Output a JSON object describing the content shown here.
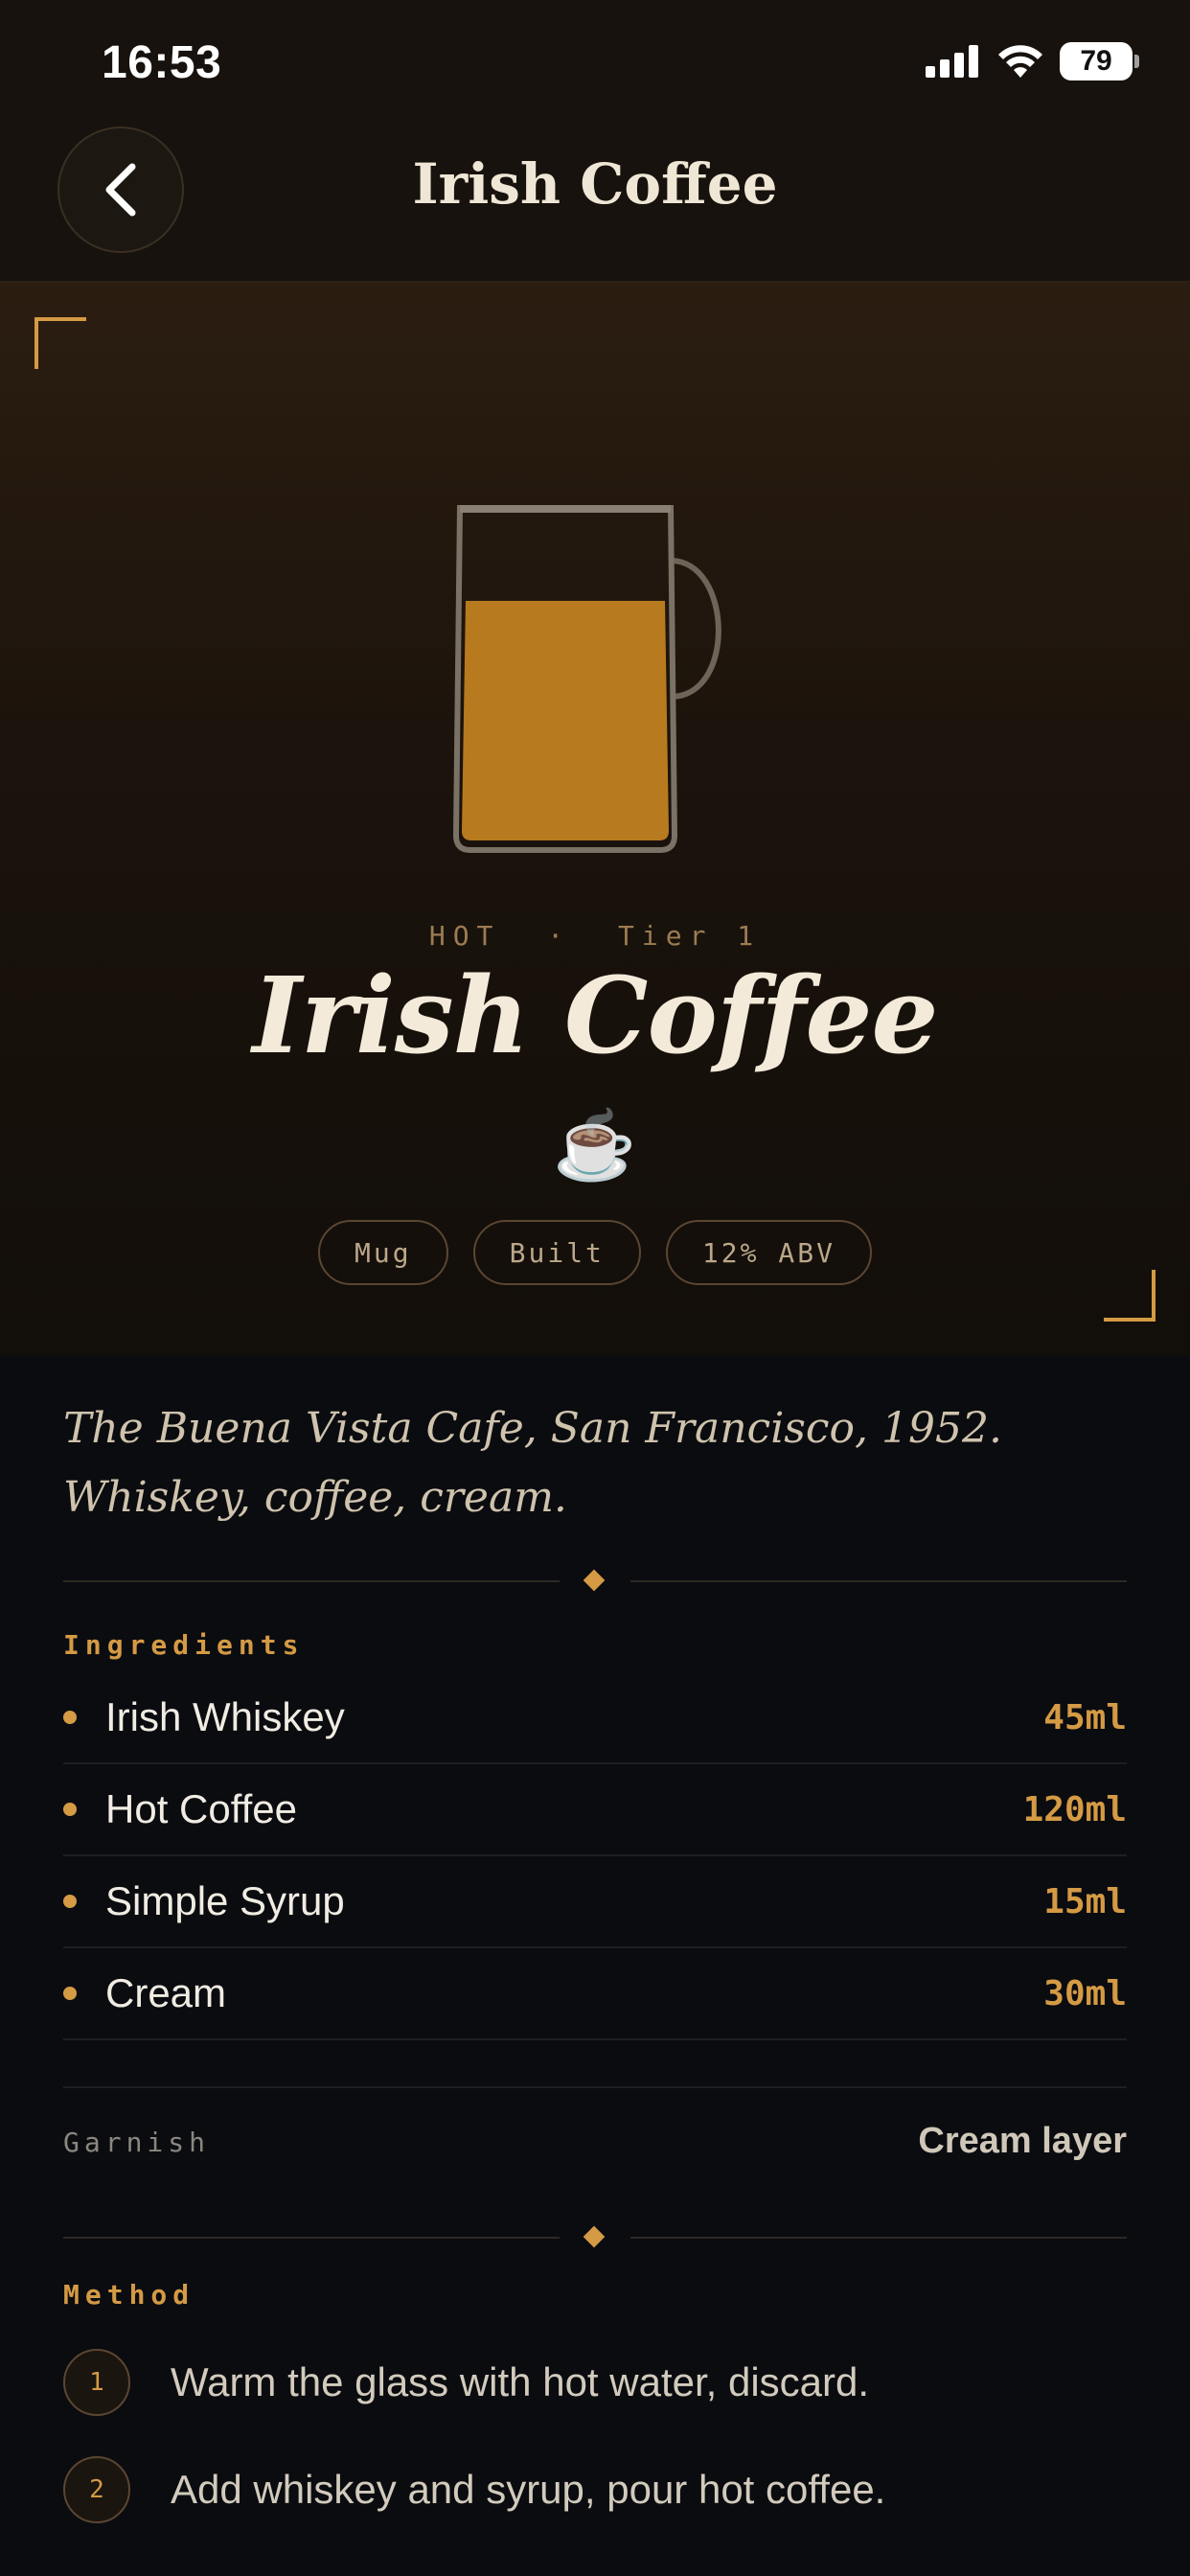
{
  "status": {
    "time": "16:53",
    "battery": "79"
  },
  "nav": {
    "title": "Irish Coffee",
    "back_icon": "chevron-left-icon"
  },
  "hero": {
    "category": "HOT",
    "separator": "·",
    "tier": "Tier 1",
    "title": "Irish Coffee",
    "emoji": "☕",
    "pills": [
      "Mug",
      "Built",
      "12% ABV"
    ],
    "fill_color": "#b87a1e"
  },
  "description": "The Buena Vista Cafe, San Francisco, 1952. Whiskey, coffee, cream.",
  "ingredients": {
    "label": "Ingredients",
    "items": [
      {
        "name": "Irish Whiskey",
        "amount": "45ml"
      },
      {
        "name": "Hot Coffee",
        "amount": "120ml"
      },
      {
        "name": "Simple Syrup",
        "amount": "15ml"
      },
      {
        "name": "Cream",
        "amount": "30ml"
      }
    ]
  },
  "garnish": {
    "label": "Garnish",
    "value": "Cream layer"
  },
  "method": {
    "label": "Method",
    "steps": [
      {
        "num": "1",
        "text": "Warm the glass with hot water, discard."
      },
      {
        "num": "2",
        "text": "Add whiskey and syrup, pour hot coffee."
      }
    ]
  },
  "colors": {
    "accent": "#d49a44",
    "background": "#0b0c10"
  }
}
